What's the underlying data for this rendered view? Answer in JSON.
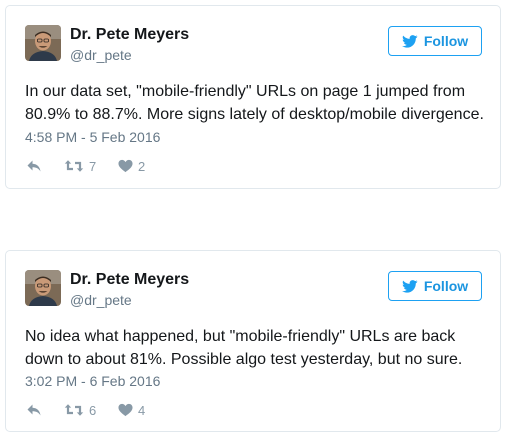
{
  "tweets": [
    {
      "author_name": "Dr. Pete Meyers",
      "handle": "@dr_pete",
      "follow_label": "Follow",
      "text_lines": [
        "In our data set, \"mobile-friendly\" URLs on page 1 jumped from",
        "80.9% to 88.7%. More signs lately of desktop/mobile divergence."
      ],
      "timestamp": "4:58 PM - 5 Feb 2016",
      "retweets": "7",
      "likes": "2"
    },
    {
      "author_name": "Dr. Pete Meyers",
      "handle": "@dr_pete",
      "follow_label": "Follow",
      "text_lines": [
        "No idea what happened, but \"mobile-friendly\" URLs are back",
        "down to about 81%. Possible algo test yesterday, but no sure."
      ],
      "timestamp": "3:02 PM - 6 Feb 2016",
      "retweets": "6",
      "likes": "4"
    }
  ],
  "icons": {
    "follow": "twitter-bird-icon",
    "reply": "reply-icon",
    "retweet": "retweet-icon",
    "like": "heart-icon",
    "avatar": "avatar-photo"
  },
  "colors": {
    "accent": "#1da1f2",
    "follow_text": "#1b95e0",
    "muted": "#657786",
    "action_gray": "#8899a6",
    "border": "#e1e8ed"
  }
}
